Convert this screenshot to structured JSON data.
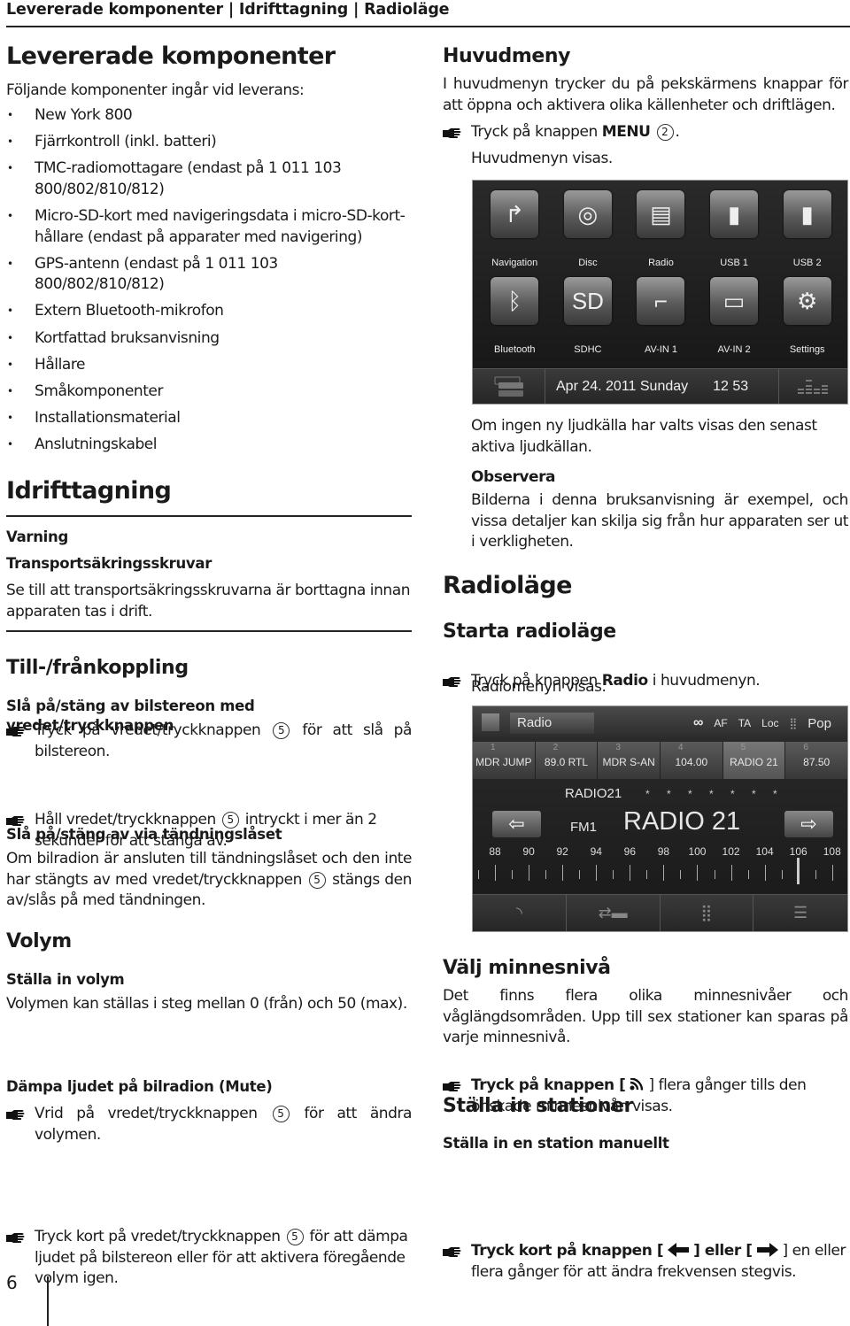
{
  "running_header": "Levererade komponenter | Idrifttagning | Radioläge",
  "left": {
    "components": {
      "title": "Levererade komponenter",
      "intro": "Följande komponenter ingår vid leverans:",
      "items": [
        "New York 800",
        "Fjärrkontroll (inkl. batteri)",
        "TMC-radiomottagare (endast på 1 011 103 800/802/810/812)",
        "Micro-SD-kort med navigeringsdata i micro-SD-kort-hållare (endast på apparater med navigering)",
        "GPS-antenn (endast på 1 011 103 800/802/810/812)",
        "Extern Bluetooth-mikrofon",
        "Kortfattad bruksanvisning",
        "Hållare",
        "Småkomponenter",
        "Installationsmaterial",
        "Anslutningskabel"
      ]
    },
    "startup": {
      "title": "Idrifttagning",
      "warning_label": "Varning",
      "warning_title": "Transportsäkringsskruvar",
      "warning_text": "Se till att transportsäkringsskruvarna är borttagna innan apparaten tas i drift."
    },
    "onoff": {
      "title": "Till-/frånkoppling",
      "knob_title": "Slå på/stäng av bilstereon med vredet/tryckknappen",
      "step1_a": "Tryck på vredet/tryckknappen",
      "step1_b": "för att slå på bilstereon.",
      "step2_a": "Håll vredet/tryckknappen",
      "step2_b": "intryckt i mer än 2 sekunder för att stänga av.",
      "ignition_title": "Slå på/stäng av via tändningslåset",
      "ignition_a": "Om bilradion är ansluten till tändningslåset och den inte har stängts av med vredet/tryckknappen",
      "ignition_b": "stängs den av/slås på med tändningen.",
      "ref": "5"
    },
    "volume": {
      "title": "Volym",
      "set_title": "Ställa in volym",
      "set_text": "Volymen kan ställas i steg mellan 0 (från) och 50 (max).",
      "step_a": "Vrid på vredet/tryckknappen",
      "step_b": "för att ändra volymen.",
      "mute_title": "Dämpa ljudet på bilradion (Mute)",
      "mute_a": "Tryck kort på vredet/tryckknappen",
      "mute_b": "för att dämpa ljudet på bilstereon eller för att aktivera föregående volym igen.",
      "ref": "5"
    }
  },
  "right": {
    "mainmenu": {
      "title": "Huvudmeny",
      "text": "I huvudmenyn trycker du på pekskärmens knappar för att öppna och aktivera olika källenheter och driftlägen.",
      "step_a": "Tryck på knappen",
      "step_bold": "MENU",
      "step_ref": "2",
      "step_end": ".",
      "result": "Huvudmenyn visas.",
      "after": "Om ingen ny ljudkälla har valts visas den senast aktiva ljudkällan.",
      "note_title": "Observera",
      "note_text": "Bilderna i denna bruksanvisning är exempel, och vissa detaljer kan skilja sig från hur apparaten ser ut i verkligheten."
    },
    "menu_screen": {
      "tiles": [
        {
          "label": "Navigation",
          "icon": "navigation-icon",
          "glyph": "↱"
        },
        {
          "label": "Disc",
          "icon": "disc-icon",
          "glyph": "◎"
        },
        {
          "label": "Radio",
          "icon": "radio-icon",
          "glyph": "▤"
        },
        {
          "label": "USB 1",
          "icon": "usb-icon",
          "glyph": "▮"
        },
        {
          "label": "USB 2",
          "icon": "usb-icon",
          "glyph": "▮"
        },
        {
          "label": "Bluetooth",
          "icon": "bluetooth-icon",
          "glyph": "ᛒ"
        },
        {
          "label": "SDHC",
          "icon": "sd-card-icon",
          "glyph": "SD"
        },
        {
          "label": "AV-IN 1",
          "icon": "av-jack-icon",
          "glyph": "⌐"
        },
        {
          "label": "AV-IN 2",
          "icon": "rca-plug-icon",
          "glyph": "▭"
        },
        {
          "label": "Settings",
          "icon": "settings-icon",
          "glyph": "⚙"
        }
      ],
      "date": "Apr 24. 2011 Sunday",
      "time": "12 53"
    },
    "radio": {
      "title": "Radioläge",
      "start_title": "Starta radioläge",
      "step_a": "Tryck på knappen",
      "step_bold": "Radio",
      "step_b": "i huvudmenyn.",
      "result": "Radiomenyn visas."
    },
    "radio_screen": {
      "source": "Radio",
      "flags": [
        "AF",
        "TA",
        "Loc"
      ],
      "eq": "Pop",
      "presets": [
        {
          "n": "1",
          "name": "MDR JUMP"
        },
        {
          "n": "2",
          "name": "89.0 RTL"
        },
        {
          "n": "3",
          "name": "MDR S-AN"
        },
        {
          "n": "4",
          "name": "104.00"
        },
        {
          "n": "5",
          "name": "RADIO 21",
          "active": true
        },
        {
          "n": "6",
          "name": "87.50"
        }
      ],
      "rds": "RADIO21",
      "stars": "* * * * * * *",
      "band": "FM1",
      "station": "RADIO 21",
      "scale_labels": [
        "88",
        "90",
        "92",
        "94",
        "96",
        "98",
        "100",
        "102",
        "104",
        "106",
        "108"
      ],
      "scale_min": 87,
      "scale_max": 108.8,
      "tuned_mhz": 105.9
    },
    "memory": {
      "title": "Välj minnesnivå",
      "text": "Det finns flera olika minnesnivåer och våglängdsområden. Upp till sex stationer kan sparas på varje minnesnivå.",
      "step_a": "Tryck på knappen [",
      "step_b": "] flera gånger tills den önskade minnesnivån visas."
    },
    "tuning": {
      "title": "Ställa in stationer",
      "manual_title": "Ställa in en station manuellt",
      "step_a": "Tryck kort på knappen [",
      "step_b": "] eller [",
      "step_c": "] en eller flera gånger för att ändra frekvensen stegvis."
    }
  },
  "page_number": "6"
}
